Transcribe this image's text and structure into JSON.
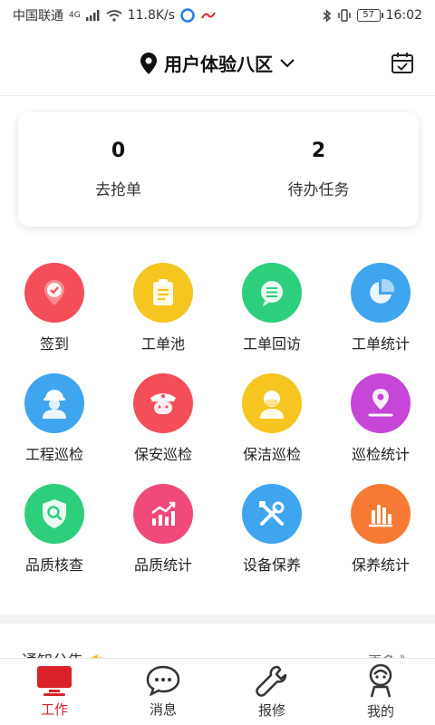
{
  "status_bar": {
    "carrier": "中国联通",
    "network": "4G",
    "speed": "11.8K/s",
    "battery": "57",
    "time": "16:02"
  },
  "header": {
    "location": "用户体验八区",
    "location_icon": "location-pin-icon",
    "calendar_icon": "calendar-check-icon"
  },
  "summary": [
    {
      "count": "0",
      "label": "去抢单"
    },
    {
      "count": "2",
      "label": "待办任务"
    }
  ],
  "grid": [
    {
      "label": "签到",
      "icon": "checkin-icon",
      "color": "#f44e58"
    },
    {
      "label": "工单池",
      "icon": "clipboard-icon",
      "color": "#f7c51f"
    },
    {
      "label": "工单回访",
      "icon": "chat-bubble-icon",
      "color": "#2dcf7c"
    },
    {
      "label": "工单统计",
      "icon": "pie-chart-icon",
      "color": "#3fa5ef"
    },
    {
      "label": "工程巡检",
      "icon": "engineer-icon",
      "color": "#3fa5ef"
    },
    {
      "label": "保安巡检",
      "icon": "guard-icon",
      "color": "#f44e58"
    },
    {
      "label": "保洁巡检",
      "icon": "cleaner-icon",
      "color": "#f7c51f"
    },
    {
      "label": "巡检统计",
      "icon": "route-icon",
      "color": "#c646d8"
    },
    {
      "label": "品质核查",
      "icon": "shield-search-icon",
      "color": "#2dcf7c"
    },
    {
      "label": "品质统计",
      "icon": "trend-chart-icon",
      "color": "#ef4a7a"
    },
    {
      "label": "设备保养",
      "icon": "tools-icon",
      "color": "#3fa5ef"
    },
    {
      "label": "保养统计",
      "icon": "bar-chart-icon",
      "color": "#f77a34"
    }
  ],
  "notice": {
    "title": "通知公告",
    "more": "更多 》"
  },
  "tabs": [
    {
      "label": "工作",
      "icon": "monitor-icon",
      "active": true
    },
    {
      "label": "消息",
      "icon": "message-icon",
      "active": false
    },
    {
      "label": "报修",
      "icon": "wrench-icon",
      "active": false
    },
    {
      "label": "我的",
      "icon": "profile-icon",
      "active": false
    }
  ],
  "colors": {
    "accent": "#d9222a"
  }
}
